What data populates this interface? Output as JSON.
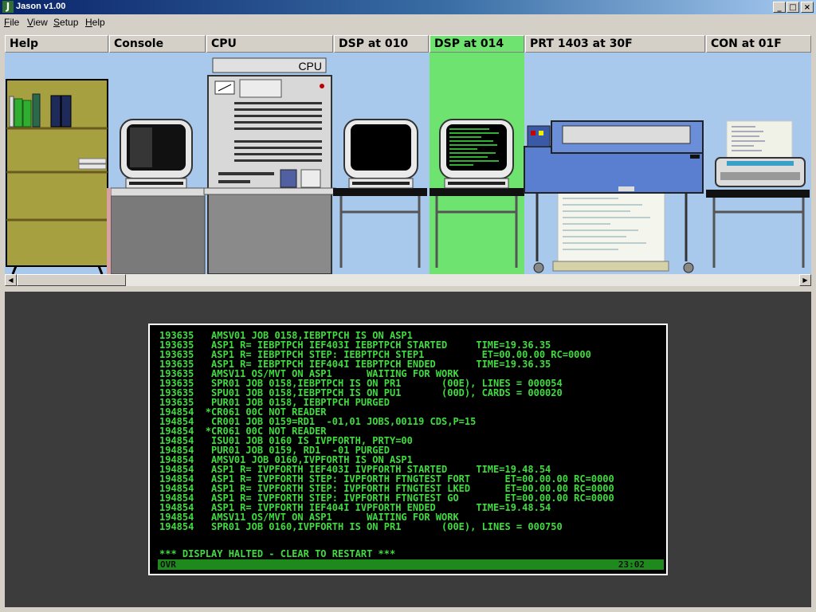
{
  "window": {
    "title": "Jason v1.00",
    "icon_letter": "J",
    "min_glyph": "_",
    "max_glyph": "□",
    "close_glyph": "×"
  },
  "menu": {
    "items": [
      {
        "underline": "F",
        "rest": "ile"
      },
      {
        "underline": "V",
        "rest": "iew"
      },
      {
        "underline": "S",
        "rest": "etup"
      },
      {
        "underline": "H",
        "rest": "elp"
      }
    ]
  },
  "tabs": [
    {
      "label": "Help"
    },
    {
      "label": "Console"
    },
    {
      "label": "CPU"
    },
    {
      "label": "DSP at 010"
    },
    {
      "label": "DSP at 014",
      "active": true
    },
    {
      "label": "PRT 1403 at 30F"
    },
    {
      "label": "CON at 01F"
    }
  ],
  "scene": {
    "cpu_label": "CPU"
  },
  "scrollbar": {
    "left_arrow": "◀",
    "right_arrow": "▶"
  },
  "terminal": {
    "lines": [
      "193635   AMSV01 JOB 0158,IEBPTPCH IS ON ASP1",
      "193635   ASP1 R= IEBPTPCH IEF403I IEBPTPCH STARTED     TIME=19.36.35",
      "193635   ASP1 R= IEBPTPCH STEP: IEBPTPCH STEP1          ET=00.00.00 RC=0000",
      "193635   ASP1 R= IEBPTPCH IEF404I IEBPTPCH ENDED       TIME=19.36.35",
      "193635   AMSV11 OS/MVT ON ASP1      WAITING FOR WORK",
      "193635   SPR01 JOB 0158,IEBPTPCH IS ON PR1       (00E), LINES = 000054",
      "193635   SPU01 JOB 0158,IEBPTPCH IS ON PU1       (00D), CARDS = 000020",
      "193635   PUR01 JOB 0158, IEBPTPCH PURGED",
      "194854  *CR061 00C NOT READER",
      "194854   CR001 JOB 0159=RD1  -01,01 JOBS,00119 CDS,P=15",
      "194854  *CR061 00C NOT READER",
      "194854   ISU01 JOB 0160 IS IVPFORTH, PRTY=00",
      "194854   PUR01 JOB 0159, RD1  -01 PURGED",
      "194854   AMSV01 JOB 0160,IVPFORTH IS ON ASP1",
      "194854   ASP1 R= IVPFORTH IEF403I IVPFORTH STARTED     TIME=19.48.54",
      "194854   ASP1 R= IVPFORTH STEP: IVPFORTH FTNGTEST FORT      ET=00.00.00 RC=0000",
      "194854   ASP1 R= IVPFORTH STEP: IVPFORTH FTNGTEST LKED      ET=00.00.00 RC=0000",
      "194854   ASP1 R= IVPFORTH STEP: IVPFORTH FTNGTEST GO        ET=00.00.00 RC=0000",
      "194854   ASP1 R= IVPFORTH IEF404I IVPFORTH ENDED       TIME=19.48.54",
      "194854   AMSV11 OS/MVT ON ASP1      WAITING FOR WORK",
      "194854   SPR01 JOB 0160,IVPFORTH IS ON PR1       (00E), LINES = 000750"
    ],
    "halt_message": "*** DISPLAY HALTED - CLEAR TO RESTART ***",
    "status_left": "OVR",
    "status_right": "23:02"
  },
  "colors": {
    "active_tab": "#6fe36f",
    "terminal_text": "#3fdc3f",
    "status_bar": "#1e8a1e",
    "scene_background": "#a8c8ec"
  }
}
